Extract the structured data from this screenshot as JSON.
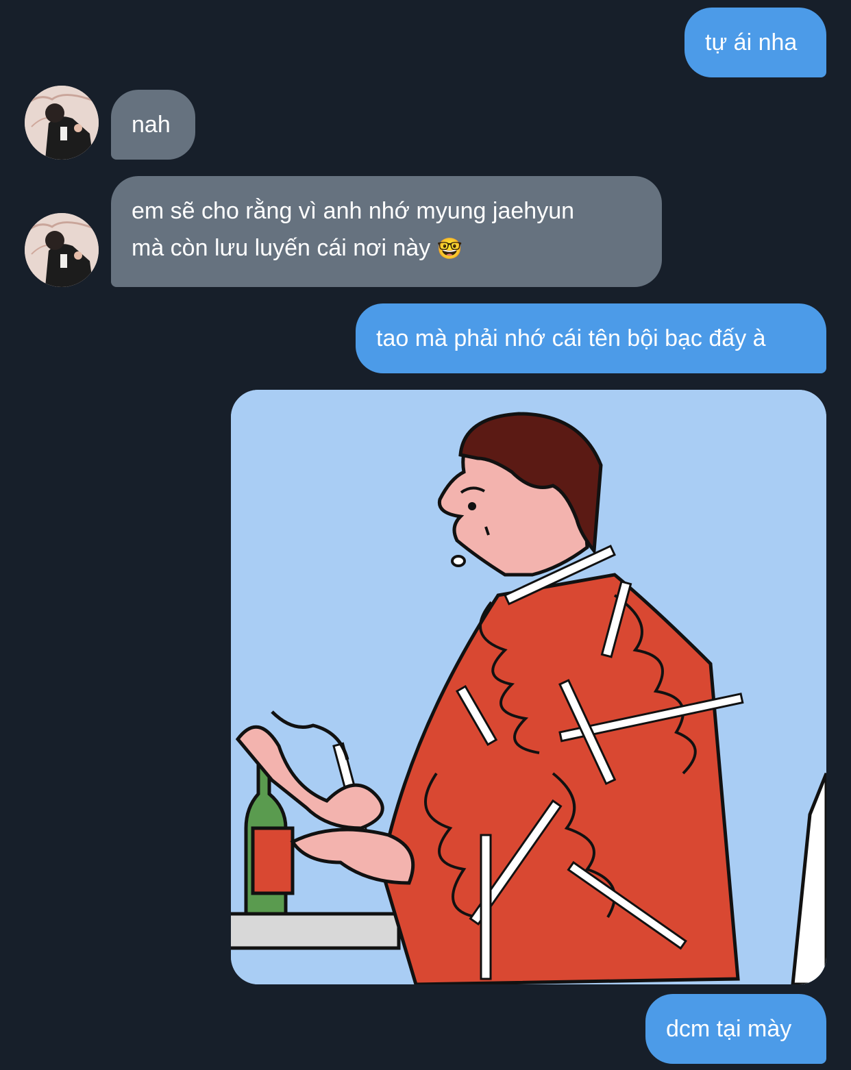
{
  "messages": [
    {
      "side": "sent",
      "text": "tự ái nha"
    },
    {
      "side": "received",
      "text": "nah"
    },
    {
      "side": "received",
      "line1": "em sẽ cho rằng vì anh nhớ myung jaehyun",
      "line2": "mà còn lưu luyến cái nơi này",
      "emoji": "🤓",
      "emoji_icon": "nerd-face-emoji"
    },
    {
      "side": "sent",
      "text": "tao mà phải nhớ cái tên bội bạc đấy à"
    },
    {
      "side": "sent",
      "type": "image"
    },
    {
      "side": "sent",
      "text": "dcm tại mày"
    }
  ],
  "colors": {
    "background": "#171f2a",
    "sent_bubble": "#4c9be8",
    "received_bubble": "#66727f",
    "image_bg": "#a9cdf4"
  }
}
